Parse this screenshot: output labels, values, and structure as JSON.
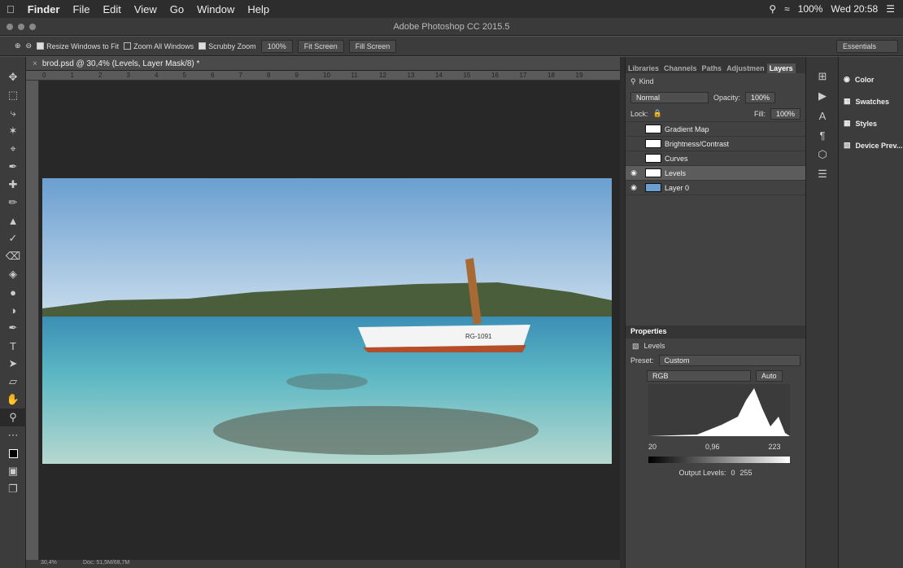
{
  "menubar": {
    "apple": "",
    "app": "Finder",
    "items": [
      "File",
      "Edit",
      "View",
      "Go",
      "Window",
      "Help"
    ],
    "battery": "100%",
    "clock": "Wed 20:58"
  },
  "window": {
    "title": "Adobe Photoshop CC 2015.5"
  },
  "options": {
    "resize": "Resize Windows to Fit",
    "zoom_all": "Zoom All Windows",
    "scrubby": "Scrubby Zoom",
    "zoom_value": "100%",
    "fit_screen": "Fit Screen",
    "fill_screen": "Fill Screen",
    "workspace": "Essentials"
  },
  "document": {
    "tab_title": "brod.psd @ 30,4% (Levels, Layer Mask/8) *",
    "zoom": "30,4%",
    "doc_size": "Doc: 51,5M/68,7M"
  },
  "ruler": {
    "marks": [
      "0",
      "1",
      "2",
      "3",
      "4",
      "5",
      "6",
      "7",
      "8",
      "9",
      "10",
      "11",
      "12",
      "13",
      "14",
      "15",
      "16",
      "17",
      "18",
      "19"
    ]
  },
  "panels": {
    "tabs": [
      "Libraries",
      "Channels",
      "Paths",
      "Adjustmen",
      "Layers"
    ],
    "active_tab": "Layers",
    "filter": "Kind",
    "blend": "Normal",
    "opacity_label": "Opacity:",
    "opacity": "100%",
    "lock_label": "Lock:",
    "fill_label": "Fill:",
    "fill": "100%"
  },
  "layers": [
    {
      "name": "Gradient Map",
      "visible": false
    },
    {
      "name": "Brightness/Contrast",
      "visible": false
    },
    {
      "name": "Curves",
      "visible": false
    },
    {
      "name": "Levels",
      "visible": true,
      "selected": true
    },
    {
      "name": "Layer 0",
      "visible": true
    }
  ],
  "properties": {
    "title": "Properties",
    "adj": "Levels",
    "preset_label": "Preset:",
    "preset": "Custom",
    "channel": "RGB",
    "auto": "Auto",
    "in_black": "20",
    "in_mid": "0,96",
    "in_white": "223",
    "out_label": "Output Levels:",
    "out_black": "0",
    "out_white": "255"
  },
  "right": {
    "items": [
      "Color",
      "Swatches",
      "Styles",
      "Device Prev..."
    ]
  }
}
